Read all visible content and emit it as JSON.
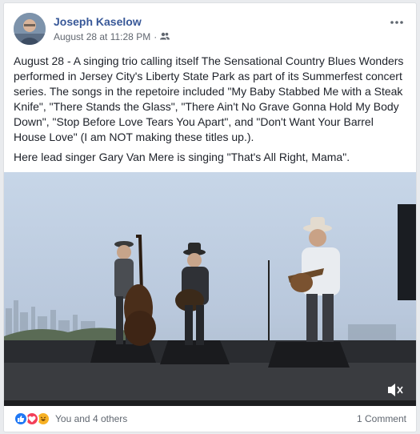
{
  "post": {
    "author": "Joseph Kaselow",
    "timestamp": "August 28 at 11:28 PM",
    "separator": "·",
    "audience_icon": "friends-icon",
    "more_icon": "more-dots-icon",
    "paragraphs": [
      "August 28 - A singing trio calling itself The Sensational Country Blues Wonders performed in Jersey City's Liberty State Park as part of its Summerfest concert series. The songs in the repetoire included \"My Baby Stabbed Me with a Steak Knife\", \"There Stands the Glass\", \"There Ain't No Grave Gonna Hold My Body Down\", \"Stop Before Love Tears You Apart\", and \"Don't Want Your Barrel House Love\" (I am NOT making these titles up.).",
      "Here lead singer Gary Van Mere is singing \"That's All Right, Mama\"."
    ]
  },
  "video": {
    "mute_icon": "speaker-muted-icon"
  },
  "footer": {
    "reactions": [
      "like-icon",
      "love-icon",
      "haha-icon"
    ],
    "reaction_label": "You and 4 others",
    "comments_label": "1 Comment"
  },
  "colors": {
    "author_link": "#385898",
    "meta_text": "#616770",
    "like": "#2078f4",
    "love": "#f33e58",
    "haha": "#f7b125"
  }
}
